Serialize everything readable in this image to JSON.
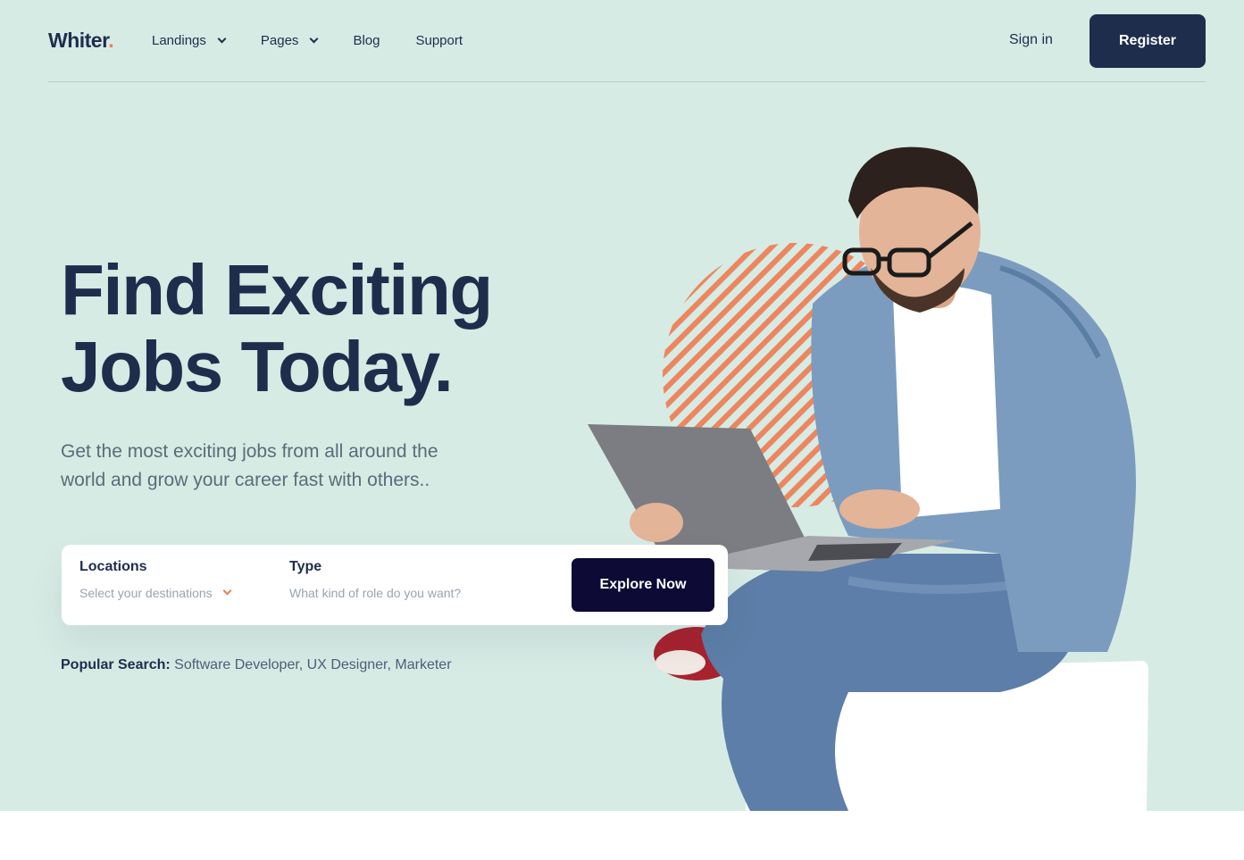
{
  "brand": {
    "name": "Whiter",
    "dot": "."
  },
  "nav": {
    "items": [
      {
        "label": "Landings",
        "dropdown": true
      },
      {
        "label": "Pages",
        "dropdown": true
      },
      {
        "label": "Blog",
        "dropdown": false
      },
      {
        "label": "Support",
        "dropdown": false
      }
    ],
    "signin_label": "Sign in",
    "register_label": "Register"
  },
  "hero": {
    "title_line1": "Find Exciting",
    "title_line2": "Jobs Today.",
    "subtitle_line1": "Get the most exciting jobs from all around the",
    "subtitle_line2": "world and grow your career fast with others.."
  },
  "search": {
    "location_label": "Locations",
    "location_placeholder": "Select your destinations",
    "type_label": "Type",
    "type_placeholder": "What kind of role do you want?",
    "button_label": "Explore Now"
  },
  "popular": {
    "label": "Popular Search:",
    "tags": "Software Developer, UX Designer, Marketer"
  },
  "colors": {
    "hero_bg": "#d6ebe4",
    "primary": "#1f2d4d",
    "accent": "#f07b50",
    "button_dark": "#0d0a36"
  },
  "icons": {
    "dropdown": "chevron-down-icon"
  }
}
